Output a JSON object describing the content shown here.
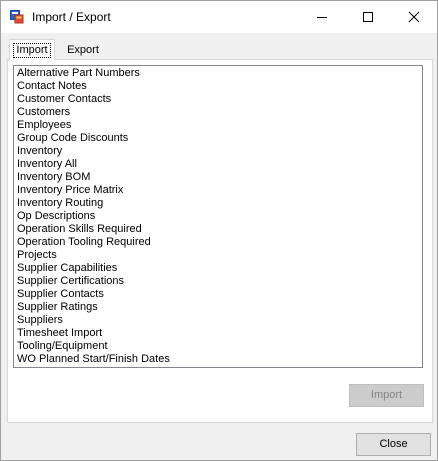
{
  "window": {
    "title": "Import / Export",
    "icons": {
      "app": "import-export-app-icon",
      "minimize": "minimize-icon",
      "maximize": "maximize-icon",
      "close": "close-icon"
    }
  },
  "tabs": [
    {
      "label": "Import",
      "selected": true
    },
    {
      "label": "Export",
      "selected": false
    }
  ],
  "import_list": {
    "items": [
      "Alternative Part Numbers",
      "Contact Notes",
      "Customer Contacts",
      "Customers",
      "Employees",
      "Group Code Discounts",
      "Inventory",
      "Inventory All",
      "Inventory BOM",
      "Inventory Price Matrix",
      "Inventory Routing",
      "Op Descriptions",
      "Operation Skills Required",
      "Operation Tooling Required",
      "Projects",
      "Supplier Capabilities",
      "Supplier Certifications",
      "Supplier Contacts",
      "Supplier Ratings",
      "Suppliers",
      "Timesheet Import",
      "Tooling/Equipment",
      "WO Planned Start/Finish Dates"
    ]
  },
  "buttons": {
    "import_label": "Import",
    "import_enabled": false,
    "close_label": "Close"
  }
}
